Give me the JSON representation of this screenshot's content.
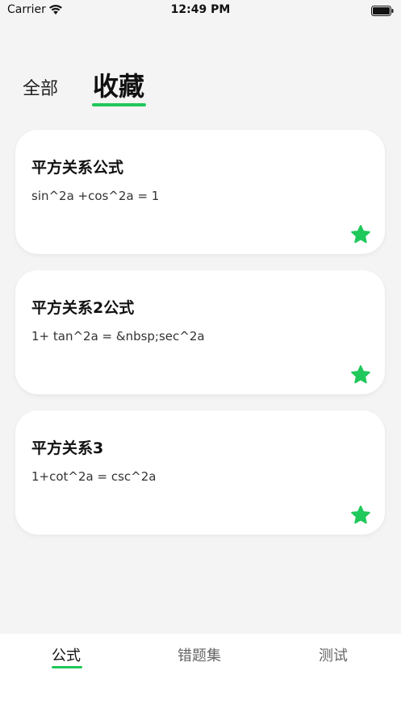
{
  "status_bar": {
    "carrier": "Carrier",
    "time": "12:49 PM"
  },
  "tabs": [
    {
      "label": "全部",
      "active": false
    },
    {
      "label": "收藏",
      "active": true
    }
  ],
  "cards": [
    {
      "title": "平方关系公式",
      "formula": "sin^2a +cos^2a = 1",
      "favorited": true
    },
    {
      "title": "平方关系2公式",
      "formula": "1+ tan^2a = &nbsp;sec^2a",
      "favorited": true
    },
    {
      "title": "平方关系3",
      "formula": "1+cot^2a = csc^2a",
      "favorited": true
    }
  ],
  "bottom_nav": [
    {
      "label": "公式",
      "active": true
    },
    {
      "label": "错题集",
      "active": false
    },
    {
      "label": "测试",
      "active": false
    }
  ],
  "colors": {
    "accent": "#1fc85a",
    "background": "#f4f4f4",
    "card": "#ffffff"
  },
  "icons": [
    "wifi-icon",
    "battery-icon",
    "star-icon"
  ]
}
